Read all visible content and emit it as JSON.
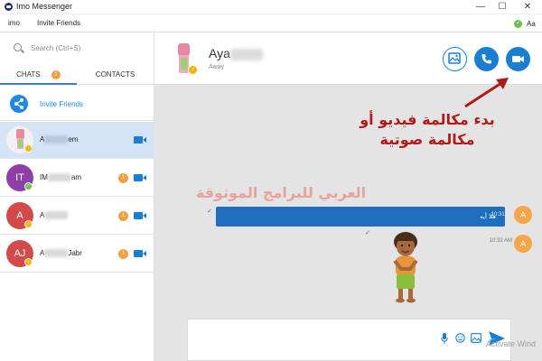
{
  "window": {
    "title": "Imo Messenger",
    "minimize": "—",
    "maximize": "☐",
    "close": "✕"
  },
  "menu": {
    "items": [
      "imo",
      "Invite Friends"
    ],
    "status_check": "✓",
    "user_initials": "Aa"
  },
  "sidebar": {
    "search_placeholder": "Search (Ctrl+S)",
    "tabs": {
      "chats": "CHATS",
      "chats_badge": "1",
      "contacts": "CONTACTS"
    },
    "invite_label": "Invite Friends",
    "chats": [
      {
        "initials": "",
        "name_prefix": "A",
        "name_suffix": "em",
        "badge": "",
        "avatar_color": "#f2f2f2",
        "presence_color": "#f4b400",
        "selected": true
      },
      {
        "initials": "IT",
        "name_prefix": "IM",
        "name_suffix": "am",
        "badge": "1",
        "avatar_color": "#8e3fa8",
        "presence_color": "#6cc04a",
        "selected": false
      },
      {
        "initials": "A",
        "name_prefix": "A",
        "name_suffix": "",
        "badge": "1",
        "avatar_color": "#d24a4a",
        "presence_color": "#f4b400",
        "selected": false
      },
      {
        "initials": "AJ",
        "name_prefix": "A",
        "name_suffix": "Jabr",
        "badge": "1",
        "avatar_color": "#d24a4a",
        "presence_color": "#f4b400",
        "selected": false
      }
    ]
  },
  "header": {
    "contact_name": "Aya",
    "contact_status": "Away"
  },
  "chat": {
    "annotation_line1": "بدء مكالمة فيديو أو",
    "annotation_line2": "مكالمة صوتية",
    "watermark": "العربي للبرامج الموثوقة",
    "messages": [
      {
        "text": "هلا أيه",
        "time": "10:31 AM",
        "avatar": "A"
      },
      {
        "text": "",
        "time": "10:32 AM",
        "avatar": "A"
      }
    ],
    "check": "✓"
  },
  "composer": {
    "placeholder": "",
    "overlay": "Activate Wind"
  },
  "colors": {
    "accent": "#1a7fd3",
    "badge": "#f0a040",
    "annotation": "#b21a1a",
    "watermark": "#e6a39e"
  }
}
